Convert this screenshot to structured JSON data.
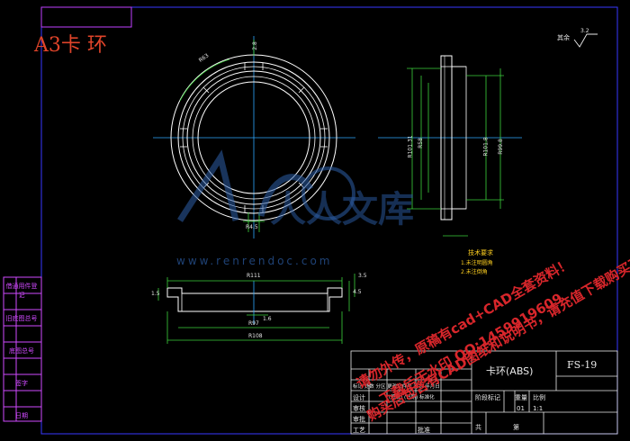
{
  "drawing": {
    "title_big": "A3卡 环",
    "roughness": "其余",
    "roughness_value": "3.2"
  },
  "dimensions": {
    "front_top": "2.8",
    "front_angle": "R63",
    "front_bottom": "R4.5",
    "side_d1": "R101.31",
    "side_d2": "R58",
    "side_d3": "R101.8",
    "side_d4": "R99.8",
    "section_top": "R111",
    "section_left": "1.5",
    "section_right1": "4.5",
    "section_right2": "3.5",
    "section_mid": "1.6",
    "section_b1": "R97",
    "section_b2": "R108"
  },
  "tech_notes": {
    "title": "技术要求",
    "line1": "1.未注明圆角",
    "line2": "2.未注倒角"
  },
  "title_block": {
    "part_name": "卡环(ABS)",
    "drawing_no": "FS-19",
    "stage_label": "阶段标记",
    "weight_label": "重量",
    "scale_label": "比例",
    "scale_value": "1:1",
    "sheet_value": "01",
    "sheets_label": "共",
    "sheet_label": "第",
    "r1": "标记 处数 分区 更改文件号 签名 年月日",
    "r2": "设计",
    "r2b": "(签名) (日期) 标准化",
    "r3": "审核",
    "r4": "审批",
    "r5": "工艺",
    "r5b": "批准"
  },
  "left_strip": [
    "借通用件登记",
    "旧底图总号",
    "底图总号",
    "签字",
    "日期"
  ],
  "watermark": {
    "site": "人人文库",
    "url": "www.renrendoc.com",
    "red1": "请勿外传，原稿有cad+CAD全套资料！",
    "red2": "下载后无水印 QQ:1459919609",
    "red3": "购买后包含有CAD图纸和说明书，请充值下载购买正版！"
  }
}
